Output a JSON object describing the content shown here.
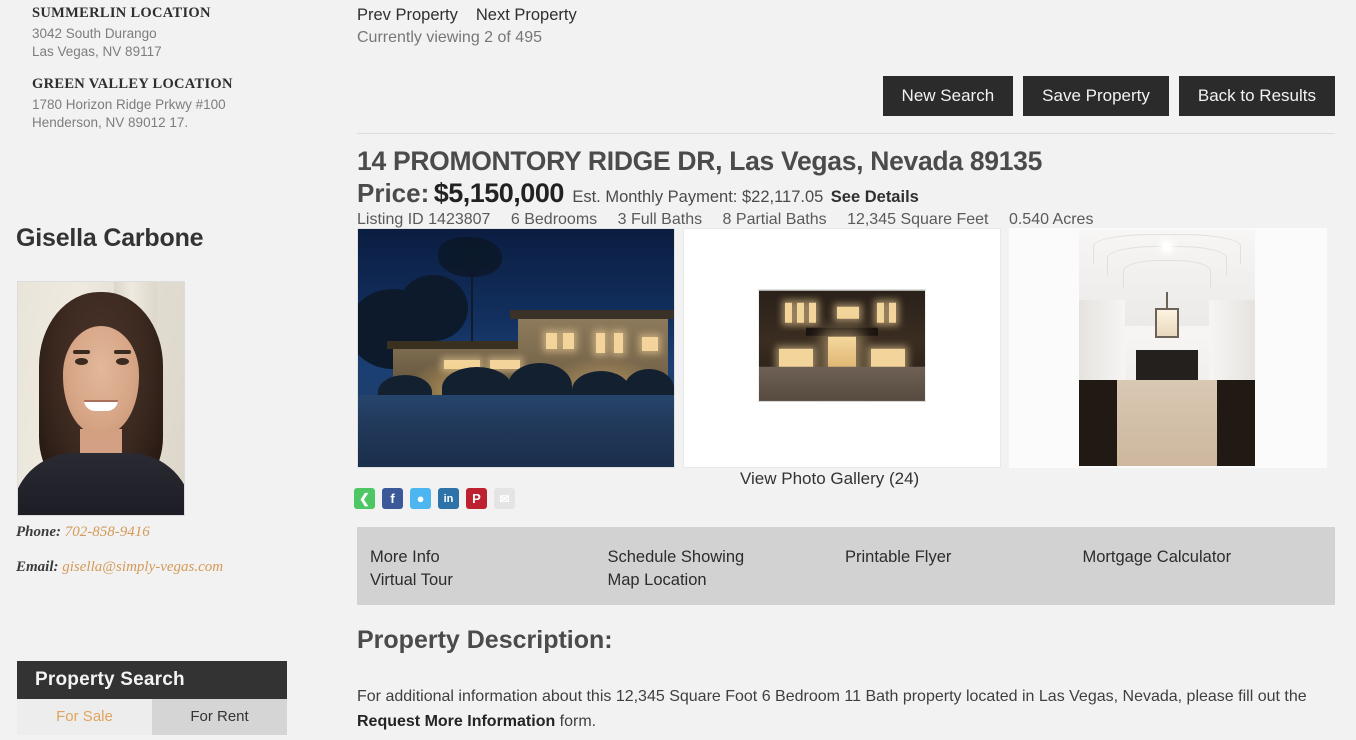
{
  "sidebar": {
    "offices": [
      {
        "title": "SUMMERLIN LOCATION",
        "line1": "3042 South Durango",
        "line2": "Las Vegas, NV 89117"
      },
      {
        "title": "GREEN VALLEY LOCATION",
        "line1": "1780 Horizon Ridge Prkwy #100",
        "line2": "Henderson, NV 89012 17."
      }
    ],
    "agent": {
      "name": "Gisella Carbone",
      "phone_label": "Phone:",
      "phone_value": "702-858-9416",
      "email_label": "Email:",
      "email_value": "gisella@simply-vegas.com"
    },
    "property_search": {
      "header": "Property Search",
      "tab_for_sale": "For Sale",
      "tab_for_rent": "For Rent"
    }
  },
  "main": {
    "nav": {
      "prev": "Prev Property",
      "next": "Next Property",
      "viewing": "Currently viewing 2 of 495"
    },
    "buttons": {
      "new_search": "New Search",
      "save_property": "Save Property",
      "back_to_results": "Back to Results"
    },
    "listing": {
      "address": "14 PROMONTORY RIDGE DR, Las Vegas, Nevada 89135",
      "price_label": "Price:",
      "price_value": "$5,150,000",
      "est_payment": "Est. Monthly Payment: $22,117.05",
      "see_details": "See Details",
      "facts": [
        "Listing ID 1423807",
        "6 Bedrooms",
        "3 Full Baths",
        "8 Partial Baths",
        "12,345 Square Feet",
        "0.540 Acres"
      ]
    },
    "gallery": {
      "view_link": "View Photo Gallery (24)",
      "photo1_alt": "twilight-exterior-front",
      "photo2_alt": "front-entry-night",
      "photo3_alt": "interior-hallway-fireplace"
    },
    "social": [
      {
        "name": "share-icon",
        "glyph": "≪",
        "color": "#4cc764"
      },
      {
        "name": "facebook-icon",
        "glyph": "f",
        "color": "#3b5998"
      },
      {
        "name": "twitter-icon",
        "glyph": "✉",
        "color": "#4db5f0"
      },
      {
        "name": "linkedin-icon",
        "glyph": "in",
        "color": "#2e73a8"
      },
      {
        "name": "pinterest-icon",
        "glyph": "P",
        "color": "#bd2130"
      },
      {
        "name": "email-icon",
        "glyph": "✉",
        "color": "#e2e2e2"
      }
    ],
    "actions": {
      "col1": [
        "More Info",
        "Virtual Tour"
      ],
      "col2": [
        "Schedule Showing",
        "Map Location"
      ],
      "col3": [
        "Printable Flyer"
      ],
      "col4": [
        "Mortgage Calculator"
      ]
    },
    "description": {
      "title": "Property Description:",
      "text_before": "For additional information about this 12,345 Square Foot 6 Bedroom 11 Bath property located in Las Vegas, Nevada, please fill out the ",
      "link": "Request More Information",
      "text_after": " form."
    }
  },
  "colors": {
    "page_bg": "#f2f2f2",
    "dark_button": "#2b2b2b",
    "accent_orange": "#d49a58",
    "action_bar": "#d2d2d2"
  }
}
